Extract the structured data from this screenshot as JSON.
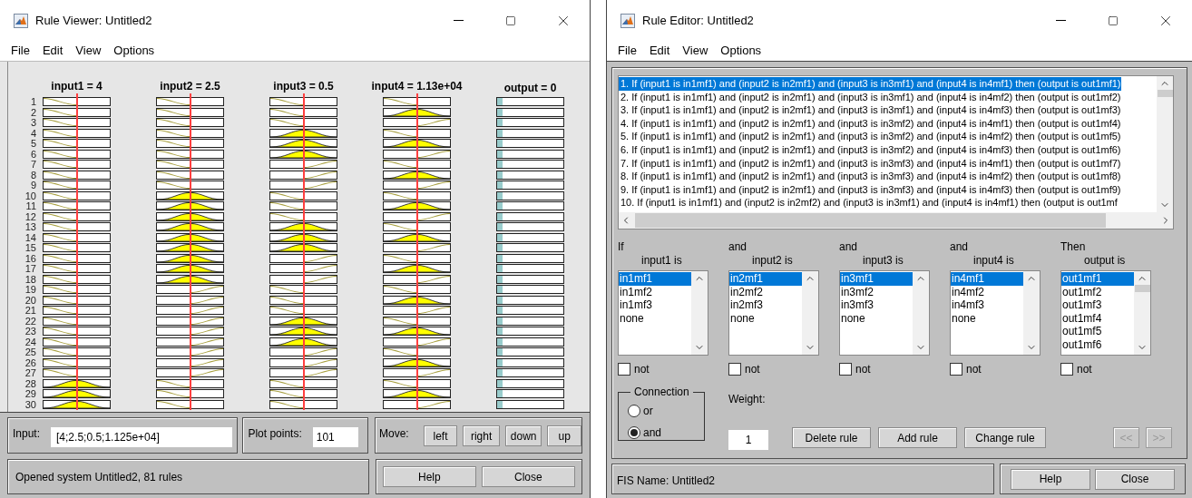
{
  "rule_viewer": {
    "window": {
      "title": "Rule Viewer: Untitled2"
    },
    "menu": [
      "File",
      "Edit",
      "View",
      "Options"
    ],
    "inputs": [
      "input1 = 4",
      "input2 = 2.5",
      "input3 = 0.5",
      "input4 = 1.13e+04"
    ],
    "output": "output = 0",
    "rows": [
      {
        "number": "1",
        "mfs": [
          {
            "kind": "low"
          },
          {
            "kind": "low"
          },
          {
            "kind": "low"
          },
          {
            "kind": "low"
          }
        ]
      },
      {
        "number": "2",
        "mfs": [
          {
            "kind": "low"
          },
          {
            "kind": "low"
          },
          {
            "kind": "low"
          },
          {
            "kind": "mid"
          }
        ]
      },
      {
        "number": "3",
        "mfs": [
          {
            "kind": "low"
          },
          {
            "kind": "low"
          },
          {
            "kind": "low"
          },
          {
            "kind": "high"
          }
        ]
      },
      {
        "number": "4",
        "mfs": [
          {
            "kind": "low"
          },
          {
            "kind": "low"
          },
          {
            "kind": "mid"
          },
          {
            "kind": "low"
          }
        ]
      },
      {
        "number": "5",
        "mfs": [
          {
            "kind": "low"
          },
          {
            "kind": "low"
          },
          {
            "kind": "mid"
          },
          {
            "kind": "mid"
          }
        ]
      },
      {
        "number": "6",
        "mfs": [
          {
            "kind": "low"
          },
          {
            "kind": "low"
          },
          {
            "kind": "mid"
          },
          {
            "kind": "high"
          }
        ]
      },
      {
        "number": "7",
        "mfs": [
          {
            "kind": "low"
          },
          {
            "kind": "low"
          },
          {
            "kind": "high"
          },
          {
            "kind": "low"
          }
        ]
      },
      {
        "number": "8",
        "mfs": [
          {
            "kind": "low"
          },
          {
            "kind": "low"
          },
          {
            "kind": "high"
          },
          {
            "kind": "mid"
          }
        ]
      },
      {
        "number": "9",
        "mfs": [
          {
            "kind": "low"
          },
          {
            "kind": "low"
          },
          {
            "kind": "high"
          },
          {
            "kind": "high"
          }
        ]
      },
      {
        "number": "10",
        "mfs": [
          {
            "kind": "low"
          },
          {
            "kind": "mid"
          },
          {
            "kind": "low"
          },
          {
            "kind": "low"
          }
        ]
      },
      {
        "number": "11",
        "mfs": [
          {
            "kind": "low"
          },
          {
            "kind": "mid"
          },
          {
            "kind": "low"
          },
          {
            "kind": "mid"
          }
        ]
      },
      {
        "number": "12",
        "mfs": [
          {
            "kind": "low"
          },
          {
            "kind": "mid"
          },
          {
            "kind": "low"
          },
          {
            "kind": "high"
          }
        ]
      },
      {
        "number": "13",
        "mfs": [
          {
            "kind": "low"
          },
          {
            "kind": "mid"
          },
          {
            "kind": "mid"
          },
          {
            "kind": "low"
          }
        ]
      },
      {
        "number": "14",
        "mfs": [
          {
            "kind": "low"
          },
          {
            "kind": "mid"
          },
          {
            "kind": "mid"
          },
          {
            "kind": "mid"
          }
        ]
      },
      {
        "number": "15",
        "mfs": [
          {
            "kind": "low"
          },
          {
            "kind": "mid"
          },
          {
            "kind": "mid"
          },
          {
            "kind": "high"
          }
        ]
      },
      {
        "number": "16",
        "mfs": [
          {
            "kind": "low"
          },
          {
            "kind": "mid"
          },
          {
            "kind": "high"
          },
          {
            "kind": "low"
          }
        ]
      },
      {
        "number": "17",
        "mfs": [
          {
            "kind": "low"
          },
          {
            "kind": "mid"
          },
          {
            "kind": "high"
          },
          {
            "kind": "mid"
          }
        ]
      },
      {
        "number": "18",
        "mfs": [
          {
            "kind": "low"
          },
          {
            "kind": "mid"
          },
          {
            "kind": "high"
          },
          {
            "kind": "high"
          }
        ]
      },
      {
        "number": "19",
        "mfs": [
          {
            "kind": "low"
          },
          {
            "kind": "high"
          },
          {
            "kind": "low"
          },
          {
            "kind": "low"
          }
        ]
      },
      {
        "number": "20",
        "mfs": [
          {
            "kind": "low"
          },
          {
            "kind": "high"
          },
          {
            "kind": "low"
          },
          {
            "kind": "mid"
          }
        ]
      },
      {
        "number": "21",
        "mfs": [
          {
            "kind": "low"
          },
          {
            "kind": "high"
          },
          {
            "kind": "low"
          },
          {
            "kind": "high"
          }
        ]
      },
      {
        "number": "22",
        "mfs": [
          {
            "kind": "low"
          },
          {
            "kind": "high"
          },
          {
            "kind": "mid"
          },
          {
            "kind": "low"
          }
        ]
      },
      {
        "number": "23",
        "mfs": [
          {
            "kind": "low"
          },
          {
            "kind": "high"
          },
          {
            "kind": "mid"
          },
          {
            "kind": "mid"
          }
        ]
      },
      {
        "number": "24",
        "mfs": [
          {
            "kind": "low"
          },
          {
            "kind": "high"
          },
          {
            "kind": "mid"
          },
          {
            "kind": "high"
          }
        ]
      },
      {
        "number": "25",
        "mfs": [
          {
            "kind": "low"
          },
          {
            "kind": "high"
          },
          {
            "kind": "high"
          },
          {
            "kind": "low"
          }
        ]
      },
      {
        "number": "26",
        "mfs": [
          {
            "kind": "low"
          },
          {
            "kind": "high"
          },
          {
            "kind": "high"
          },
          {
            "kind": "mid"
          }
        ]
      },
      {
        "number": "27",
        "mfs": [
          {
            "kind": "low"
          },
          {
            "kind": "high"
          },
          {
            "kind": "high"
          },
          {
            "kind": "high"
          }
        ]
      },
      {
        "number": "28",
        "mfs": [
          {
            "kind": "mid"
          },
          {
            "kind": "low"
          },
          {
            "kind": "low"
          },
          {
            "kind": "low"
          }
        ]
      },
      {
        "number": "29",
        "mfs": [
          {
            "kind": "mid"
          },
          {
            "kind": "low"
          },
          {
            "kind": "low"
          },
          {
            "kind": "mid"
          }
        ]
      },
      {
        "number": "30",
        "mfs": [
          {
            "kind": "mid"
          },
          {
            "kind": "low"
          },
          {
            "kind": "low"
          },
          {
            "kind": "high"
          }
        ]
      }
    ],
    "input": {
      "label": "Input:",
      "value": "[4;2.5;0.5;1.125e+04]"
    },
    "plot_points": {
      "label": "Plot points:",
      "value": "101"
    },
    "move": {
      "label": "Move:",
      "buttons": [
        "left",
        "right",
        "down",
        "up"
      ]
    },
    "status": "Opened system Untitled2, 81 rules",
    "buttons": [
      "Help",
      "Close"
    ]
  },
  "rule_editor": {
    "window": {
      "title": "Rule Editor: Untitled2"
    },
    "menu": [
      "File",
      "Edit",
      "View",
      "Options"
    ],
    "rules": [
      {
        "text": "1. If (input1 is in1mf1) and (input2 is in2mf1) and (input3 is in3mf1) and (input4 is in4mf1) then (output is out1mf1)",
        "selected": true
      },
      {
        "text": "2. If (input1 is in1mf1) and (input2 is in2mf1) and (input3 is in3mf1) and (input4 is in4mf2) then (output is out1mf2)",
        "selected": false
      },
      {
        "text": "3. If (input1 is in1mf1) and (input2 is in2mf1) and (input3 is in3mf1) and (input4 is in4mf3) then (output is out1mf3)",
        "selected": false
      },
      {
        "text": "4. If (input1 is in1mf1) and (input2 is in2mf1) and (input3 is in3mf2) and (input4 is in4mf1) then (output is out1mf4)",
        "selected": false
      },
      {
        "text": "5. If (input1 is in1mf1) and (input2 is in2mf1) and (input3 is in3mf2) and (input4 is in4mf2) then (output is out1mf5)",
        "selected": false
      },
      {
        "text": "6. If (input1 is in1mf1) and (input2 is in2mf1) and (input3 is in3mf2) and (input4 is in4mf3) then (output is out1mf6)",
        "selected": false
      },
      {
        "text": "7. If (input1 is in1mf1) and (input2 is in2mf1) and (input3 is in3mf3) and (input4 is in4mf1) then (output is out1mf7)",
        "selected": false
      },
      {
        "text": "8. If (input1 is in1mf1) and (input2 is in2mf1) and (input3 is in3mf3) and (input4 is in4mf2) then (output is out1mf8)",
        "selected": false
      },
      {
        "text": "9. If (input1 is in1mf1) and (input2 is in2mf1) and (input3 is in3mf3) and (input4 is in4mf3) then (output is out1mf9)",
        "selected": false
      },
      {
        "text": "10. If (input1 is in1mf1) and (input2 is in2mf2) and (input3 is in3mf1) and (input4 is in4mf1) then (output is out1mf",
        "selected": false
      }
    ],
    "variables": [
      {
        "connector": "If",
        "label": "input1 is",
        "options": [
          {
            "text": "in1mf1",
            "selected": true
          },
          {
            "text": "in1mf2",
            "selected": false
          },
          {
            "text": "in1mf3",
            "selected": false
          },
          {
            "text": "none",
            "selected": false
          }
        ],
        "not": {
          "label": "not",
          "checked": false
        }
      },
      {
        "connector": "and",
        "label": "input2 is",
        "options": [
          {
            "text": "in2mf1",
            "selected": true
          },
          {
            "text": "in2mf2",
            "selected": false
          },
          {
            "text": "in2mf3",
            "selected": false
          },
          {
            "text": "none",
            "selected": false
          }
        ],
        "not": {
          "label": "not",
          "checked": false
        }
      },
      {
        "connector": "and",
        "label": "input3 is",
        "options": [
          {
            "text": "in3mf1",
            "selected": true
          },
          {
            "text": "in3mf2",
            "selected": false
          },
          {
            "text": "in3mf3",
            "selected": false
          },
          {
            "text": "none",
            "selected": false
          }
        ],
        "not": {
          "label": "not",
          "checked": false
        }
      },
      {
        "connector": "and",
        "label": "input4 is",
        "options": [
          {
            "text": "in4mf1",
            "selected": true
          },
          {
            "text": "in4mf2",
            "selected": false
          },
          {
            "text": "in4mf3",
            "selected": false
          },
          {
            "text": "none",
            "selected": false
          }
        ],
        "not": {
          "label": "not",
          "checked": false
        }
      },
      {
        "connector": "Then",
        "label": "output is",
        "options": [
          {
            "text": "out1mf1",
            "selected": true
          },
          {
            "text": "out1mf2",
            "selected": false
          },
          {
            "text": "out1mf3",
            "selected": false
          },
          {
            "text": "out1mf4",
            "selected": false
          },
          {
            "text": "out1mf5",
            "selected": false
          },
          {
            "text": "out1mf6",
            "selected": false
          }
        ],
        "not": {
          "label": "not",
          "checked": false
        }
      }
    ],
    "connection": {
      "title": "Connection",
      "options": [
        {
          "label": "or",
          "selected": false
        },
        {
          "label": "and",
          "selected": true
        }
      ]
    },
    "weight": {
      "label": "Weight:",
      "value": "1"
    },
    "actions": [
      "Delete rule",
      "Add rule",
      "Change rule"
    ],
    "nav": [
      {
        "label": "<<",
        "disabled": true
      },
      {
        "label": ">>",
        "disabled": true
      }
    ],
    "status": "FIS Name: Untitled2",
    "buttons": [
      "Help",
      "Close"
    ]
  }
}
